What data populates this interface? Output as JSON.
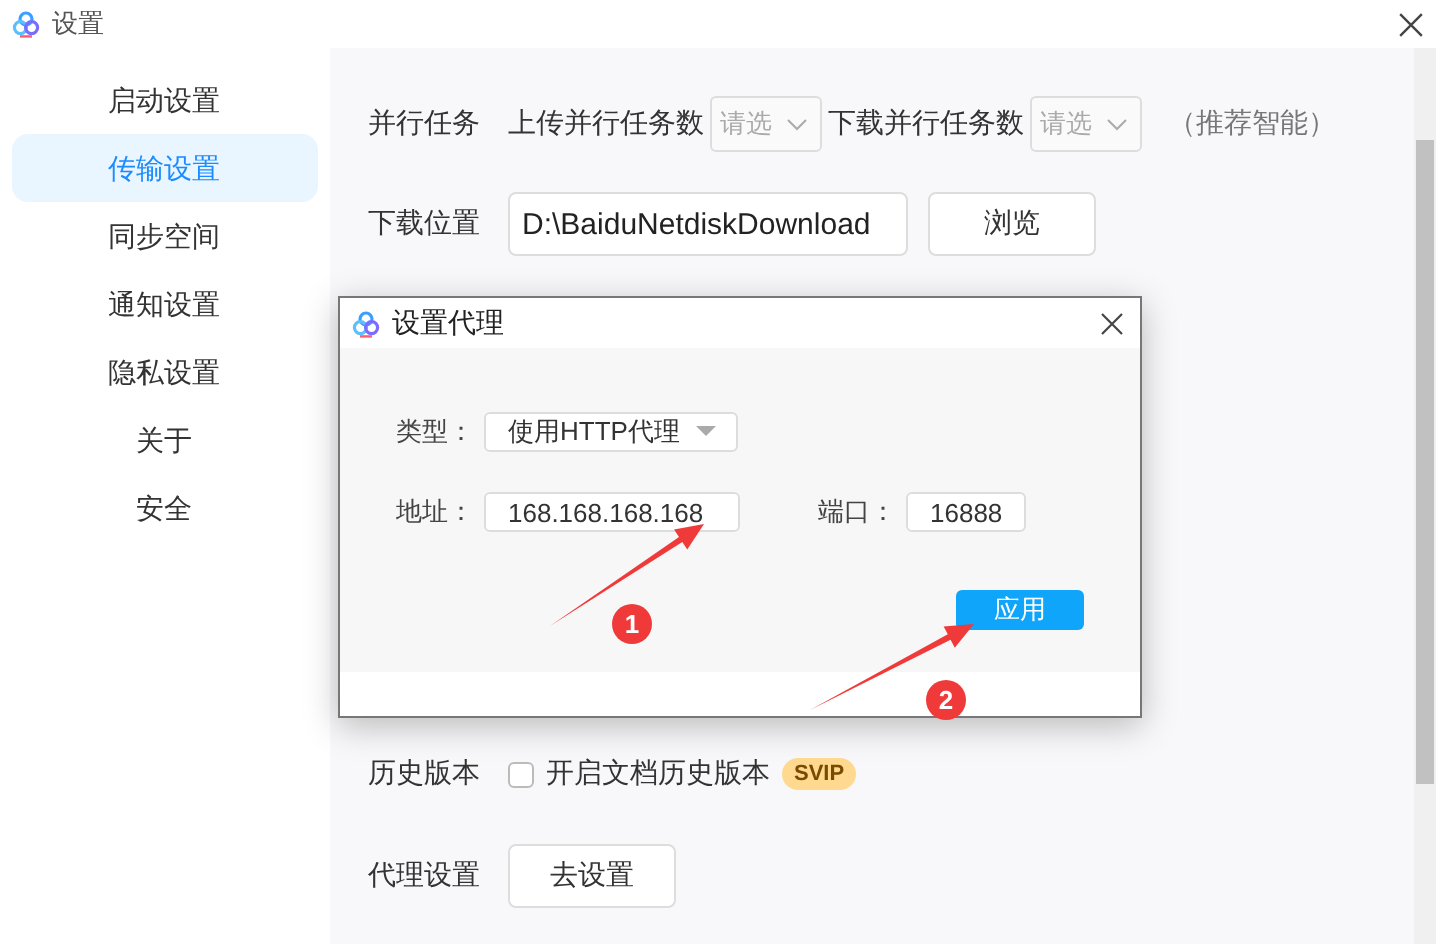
{
  "window": {
    "title": "设置"
  },
  "sidebar": {
    "items": [
      {
        "label": "启动设置",
        "selected": false
      },
      {
        "label": "传输设置",
        "selected": true
      },
      {
        "label": "同步空间",
        "selected": false
      },
      {
        "label": "通知设置",
        "selected": false
      },
      {
        "label": "隐私设置",
        "selected": false,
        "children": [
          {
            "label": "关于",
            "selected": false
          },
          {
            "label": "安全",
            "selected": false
          }
        ]
      }
    ]
  },
  "settings": {
    "parallel_tasks": {
      "label": "并行任务",
      "upload_label": "上传并行任务数",
      "upload_select": {
        "placeholder": "请选"
      },
      "download_label": "下载并行任务数",
      "download_select": {
        "placeholder": "请选"
      },
      "hint": "（推荐智能）"
    },
    "download_location": {
      "label": "下载位置",
      "path": "D:\\BaiduNetdiskDownload",
      "browse_button": "浏览"
    },
    "history": {
      "label": "历史版本",
      "checkbox": {
        "label": "开启文档历史版本",
        "checked": false
      },
      "badge": "SVIP"
    },
    "proxy": {
      "label": "代理设置",
      "button": "去设置"
    }
  },
  "dialog": {
    "title": "设置代理",
    "type_label": "类型：",
    "type_value": "使用HTTP代理",
    "address_label": "地址：",
    "address_value": "168.168.168.168",
    "port_label": "端口：",
    "port_value": "16888",
    "apply_button": "应用"
  },
  "annotations": [
    {
      "number": "1"
    },
    {
      "number": "2"
    }
  ]
}
